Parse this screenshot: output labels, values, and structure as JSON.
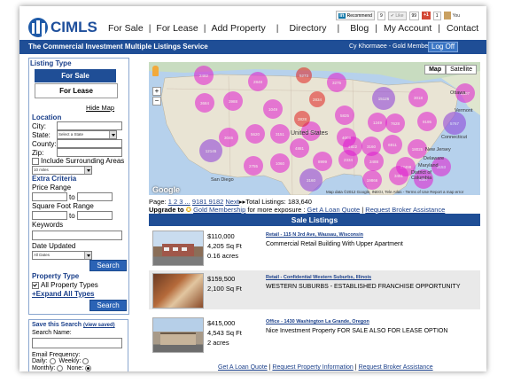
{
  "header": {
    "logo_text": "CIMLS",
    "nav": [
      "For Sale",
      "For Lease",
      "Add Property",
      "Directory",
      "Blog",
      "My Account",
      "Contact"
    ],
    "social": {
      "linkedin_label": "Recommend",
      "linkedin_count": "9",
      "like_label": "Like",
      "like_count": "99",
      "gplus_label": "+1",
      "gplus_count": "1",
      "you_label": "You"
    }
  },
  "bluebar": {
    "tagline": "The Commercial Investment Multiple Listings Service",
    "member": "Cy Khormaee - Gold Member",
    "logoff": "Log Off"
  },
  "sidebar": {
    "listing_type_title": "Listing Type",
    "for_sale": "For Sale",
    "for_lease": "For Lease",
    "hide_map": "Hide Map",
    "location_title": "Location",
    "city": "City:",
    "state": "State:",
    "state_value": "Select a State",
    "county": "County:",
    "zip": "Zip:",
    "include_surrounding": "Include Surrounding Areas",
    "radius_value": "10 miles",
    "extra_criteria": "Extra Criteria",
    "price_range": "Price Range",
    "to1": "to",
    "sqft_range": "Square Foot Range",
    "to2": "to",
    "keywords": "Keywords",
    "date_updated": "Date Updated",
    "date_value": "All Dates",
    "search1": "Search",
    "property_type": "Property Type",
    "all_types": "All Property Types",
    "expand_all": "+Expand All Types",
    "search2": "Search"
  },
  "save_search": {
    "title": "Save this Search",
    "view_saved": "(view saved)",
    "name_label": "Search Name:",
    "freq_label": "Email Frequency:",
    "daily": "Daily:",
    "weekly": "Weekly:",
    "monthly": "Monthly:",
    "none": "None:"
  },
  "map": {
    "type_map": "Map",
    "type_satellite": "Satellite",
    "footer": "Map data ©2012 Google, INEGI, Tele Atlas - Terms of Use  Report a map error",
    "google": "Google",
    "labels": [
      "United States",
      "San Diego",
      "Ottawa",
      "Vermont",
      "Connecticut",
      "New Jersey",
      "Delaware",
      "Maryland",
      "District of Columbia"
    ],
    "clusters": [
      "2482",
      "2848",
      "5273",
      "3275",
      "3684",
      "3988",
      "1049",
      "15126",
      "2607",
      "3018",
      "5767",
      "2834",
      "5785",
      "3151",
      "5620",
      "3046",
      "3828",
      "5825",
      "1249",
      "7628",
      "9195",
      "6911",
      "18025",
      "3160",
      "4922",
      "4008",
      "12145",
      "1060",
      "2755",
      "8999",
      "2334",
      "3488",
      "23498",
      "3160",
      "19866",
      "3451",
      "8397",
      "3153",
      "4881"
    ]
  },
  "pager": {
    "label": "Page:",
    "pages": "1 2 3 ...",
    "last_pages": "9181 9182",
    "next": "Next",
    "total": "Total Listings: 183,640"
  },
  "upgrade": {
    "text1": "Upgrade to",
    "gold": "Gold Membership",
    "text2": "for more exposure :",
    "loan": "Get A Loan Quote",
    "sep": "|",
    "broker": "Request Broker Assistance"
  },
  "sale_listings_title": "Sale Listings",
  "listings": [
    {
      "price": "$110,000",
      "sqft": "4,205 Sq Ft",
      "acres": "0.16 acres",
      "title": "Retail - 115 N 3rd Ave, Wausau, Wisconsin",
      "desc": "Commercial Retail Building With Upper Apartment"
    },
    {
      "price": "$159,500",
      "sqft": "2,100 Sq Ft",
      "acres": "",
      "title": "Retail - Confidential Western Suburbs, Illinois",
      "desc": "WESTERN SUBURBS - ESTABLISHED FRANCHISE OPPORTUNITY"
    },
    {
      "price": "$415,000",
      "sqft": "4,543 Sq Ft",
      "acres": "2 acres",
      "title": "Office - 1430 Washington La Grande, Oregon",
      "desc": "Nice Investment Property FOR SALE ALSO FOR LEASE OPTION"
    }
  ],
  "footer_links": {
    "loan": "Get A Loan Quote",
    "info": "Request Property Information",
    "broker": "Request Broker Assistance",
    "sep": "|"
  },
  "colors": {
    "brand_blue": "#1f4e96",
    "cluster_pink": "#e01bd0",
    "cluster_purple": "#8b3bd9",
    "cluster_red": "#e02020"
  }
}
